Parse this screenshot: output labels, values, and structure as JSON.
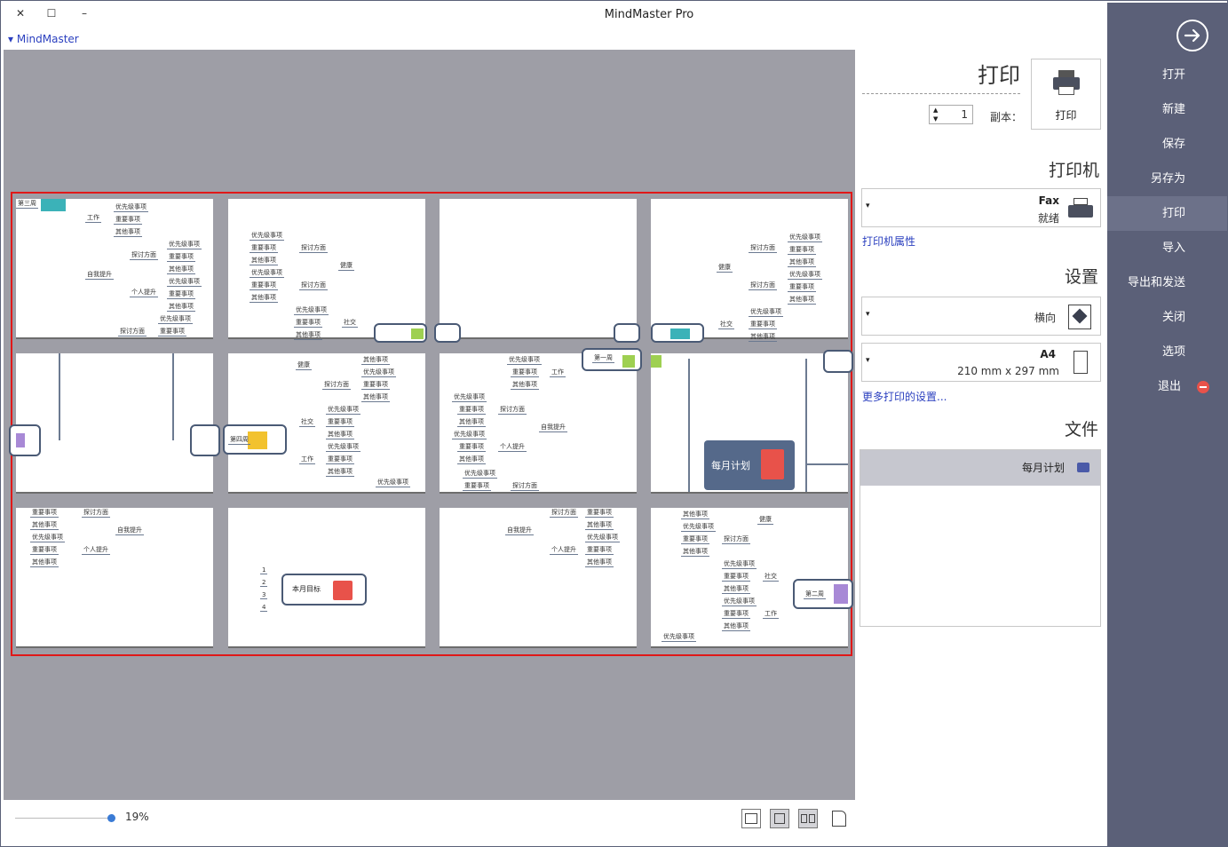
{
  "window": {
    "title": "MindMaster Pro",
    "app_menu_label": "MindMaster",
    "minimize_glyph": "–",
    "maximize_glyph": "☐",
    "close_glyph": "✕"
  },
  "sidebar": {
    "back_icon": "arrow-right-circle-icon",
    "items": [
      {
        "label": "打开"
      },
      {
        "label": "新建"
      },
      {
        "label": "保存"
      },
      {
        "label": "另存为"
      },
      {
        "label": "打印",
        "active": true
      },
      {
        "label": "导入"
      },
      {
        "label": "导出和发送"
      },
      {
        "label": "关闭"
      },
      {
        "label": "选项"
      },
      {
        "label": "退出",
        "icon": "exit-icon"
      }
    ]
  },
  "print_panel": {
    "title": "打印",
    "print_button_label": "打印",
    "copies_label": "副本：",
    "copies_value": "1",
    "printer_section": "打印机",
    "printer_name": "Fax",
    "printer_status": "就绪",
    "printer_properties_link": "打印机属性",
    "settings_section": "设置",
    "orientation_value": "横向",
    "paper_name": "A4",
    "paper_size": "210 mm x 297 mm",
    "more_settings_link": "更多打印的设置...",
    "file_section": "文件",
    "file_name": "每月计划"
  },
  "preview": {
    "zoom_value": "19%",
    "view_buttons": [
      "fit-width-icon",
      "single-page-icon",
      "two-page-icon",
      "page-icon"
    ],
    "mindmap_text": {
      "leaf": "优先级事项",
      "leaf2": "重要事项",
      "leaf3": "其他事项",
      "work": "工作",
      "self": "自我提升",
      "personal": "个人提升",
      "social": "社交",
      "health": "健康",
      "tools": "探讨方面",
      "week1": "第一周",
      "week2": "第二周",
      "week3": "第三周",
      "week4": "第四周",
      "central": "每月计划",
      "month": "本月目标",
      "n1": "1",
      "n2": "2",
      "n3": "3",
      "n4": "4"
    }
  },
  "colors": {
    "sidebar_bg": "#5b6078",
    "sidebar_active": "#6c7189",
    "preview_bg": "#9e9ea6",
    "highlight_frame": "#e01818",
    "link": "#2a3fbf",
    "central_topic": "#55698a",
    "note_red": "#e8524a"
  }
}
